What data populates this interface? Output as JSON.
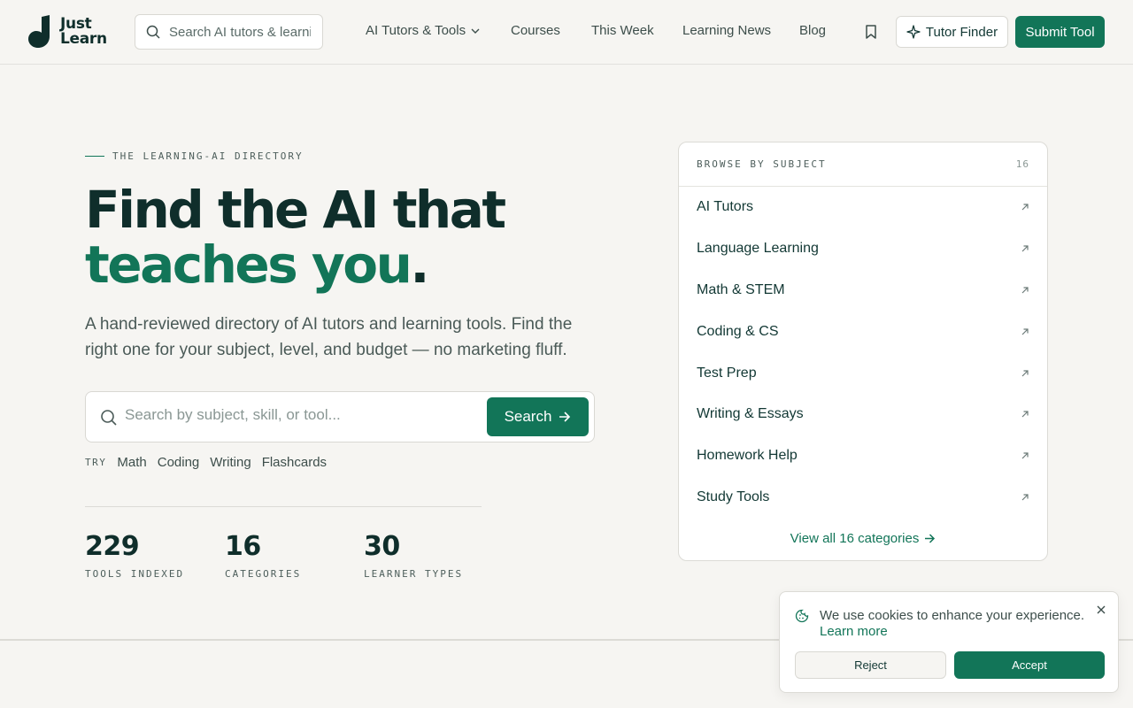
{
  "brand": {
    "line1": "Just",
    "line2": "Learn",
    "accent": "#127558",
    "ink": "#0f2e2b"
  },
  "header": {
    "search_placeholder": "Search AI tutors & learning tools",
    "nav": [
      {
        "label": "AI Tutors & Tools",
        "has_dropdown": true
      },
      {
        "label": "Courses"
      },
      {
        "label": "This Week"
      },
      {
        "label": "Learning News"
      },
      {
        "label": "Blog"
      }
    ],
    "bookmark_icon": "bookmark-icon",
    "tutor_finder": "Tutor Finder",
    "submit": "Submit Tool"
  },
  "hero": {
    "eyebrow": "THE LEARNING-AI DIRECTORY",
    "title_line1": "Find the AI that",
    "title_line2": "teaches you",
    "title_dot": ".",
    "lede": "A hand-reviewed directory of AI tutors and learning tools. Find the right one for your subject, level, and budget — no marketing fluff.",
    "search_placeholder": "Search by subject, skill, or tool...",
    "search_button": "Search",
    "try_label": "TRY",
    "try_chips": [
      "Math",
      "Coding",
      "Writing",
      "Flashcards"
    ],
    "stats": [
      {
        "value": "229",
        "caption": "TOOLS INDEXED"
      },
      {
        "value": "16",
        "caption": "CATEGORIES"
      },
      {
        "value": "30",
        "caption": "LEARNER TYPES"
      }
    ]
  },
  "browse": {
    "heading": "BROWSE BY SUBJECT",
    "count": "16",
    "categories": [
      "AI Tutors",
      "Language Learning",
      "Math & STEM",
      "Coding & CS",
      "Test Prep",
      "Writing & Essays",
      "Homework Help",
      "Study Tools"
    ],
    "view_all": "View all 16 categories"
  },
  "cookie": {
    "message": "We use cookies to enhance your experience.",
    "learn_more": "Learn more",
    "reject": "Reject",
    "accept": "Accept"
  }
}
